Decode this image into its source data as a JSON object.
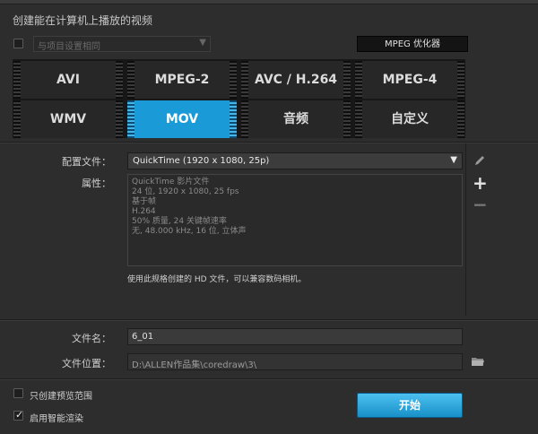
{
  "title": "创建能在计算机上播放的视频",
  "project_settings": {
    "placeholder": "与项目设置相同",
    "checked": false
  },
  "mpeg_optimizer_label": "MPEG 优化器",
  "formats": [
    {
      "label": "AVI",
      "selected": false
    },
    {
      "label": "MPEG-2",
      "selected": false
    },
    {
      "label": "AVC / H.264",
      "selected": false
    },
    {
      "label": "MPEG-4",
      "selected": false
    },
    {
      "label": "WMV",
      "selected": false
    },
    {
      "label": "MOV",
      "selected": true
    },
    {
      "label": "音频",
      "selected": false
    },
    {
      "label": "自定义",
      "selected": false
    }
  ],
  "profile": {
    "label": "配置文件：",
    "value": "QuickTime (1920 x 1080, 25p)"
  },
  "properties": {
    "label": "属性：",
    "lines": [
      "QuickTime 影片文件",
      "24 位, 1920 x 1080, 25 fps",
      "基于帧",
      "H.264",
      "50% 质量, 24 关键帧速率",
      "无, 48.000 kHz, 16 位, 立体声"
    ]
  },
  "description": "使用此规格创建的 HD 文件，可以兼容数码相机。",
  "filename": {
    "label": "文件名：",
    "value": "6_01"
  },
  "location": {
    "label": "文件位置：",
    "value": "D:\\ALLEN作品集\\coredraw\\3\\"
  },
  "options": [
    {
      "label": "只创建预览范围",
      "checked": false
    },
    {
      "label": "启用智能渲染",
      "checked": true
    }
  ],
  "start_label": "开始",
  "icons": {
    "edit": "pencil-icon",
    "add": "plus-icon",
    "remove": "minus-icon",
    "browse": "folder-icon"
  }
}
